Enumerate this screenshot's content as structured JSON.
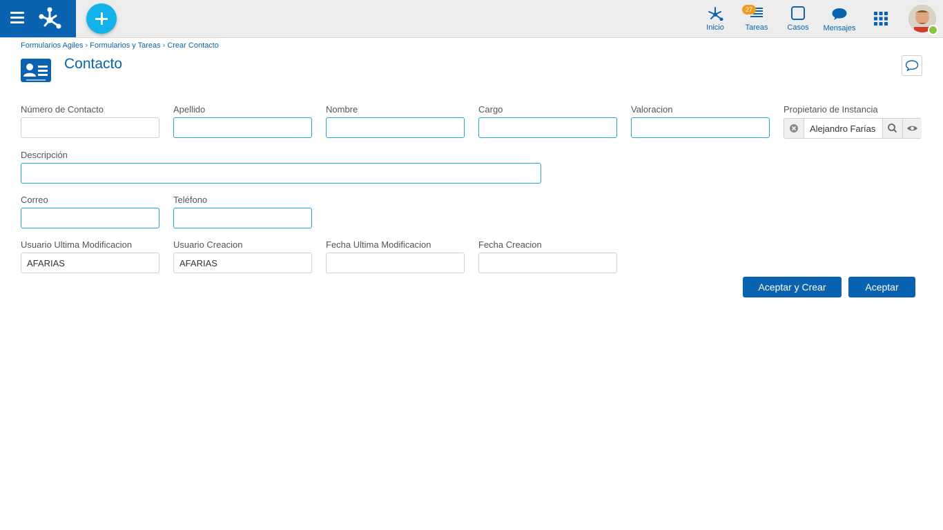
{
  "topbar": {
    "nav": [
      {
        "label": "Inicio",
        "icon": "home-network-icon"
      },
      {
        "label": "Tareas",
        "icon": "tasks-icon",
        "badge": "27"
      },
      {
        "label": "Casos",
        "icon": "cases-icon"
      },
      {
        "label": "Mensajes",
        "icon": "messages-icon"
      }
    ],
    "accent": "#0a63b1",
    "add_color": "#12b3ea",
    "badge_color": "#f29c1f"
  },
  "breadcrumb": [
    "Formularios Agiles",
    "Formularios y Tareas",
    "Crear Contacto"
  ],
  "page": {
    "title": "Contacto"
  },
  "form": {
    "numero": {
      "label": "Número de Contacto",
      "value": ""
    },
    "apellido": {
      "label": "Apellido",
      "value": ""
    },
    "nombre": {
      "label": "Nombre",
      "value": ""
    },
    "cargo": {
      "label": "Cargo",
      "value": ""
    },
    "valoracion": {
      "label": "Valoracion",
      "value": ""
    },
    "propietario": {
      "label": "Propietario de Instancia",
      "value": "Alejandro Farías"
    },
    "descripcion": {
      "label": "Descripción",
      "value": ""
    },
    "correo": {
      "label": "Correo",
      "value": ""
    },
    "telefono": {
      "label": "Teléfono",
      "value": ""
    },
    "usuario_mod": {
      "label": "Usuario Ultima Modificacion",
      "value": "AFARIAS"
    },
    "usuario_crea": {
      "label": "Usuario Creacion",
      "value": "AFARIAS"
    },
    "fecha_mod": {
      "label": "Fecha Ultima Modificacion",
      "value": ""
    },
    "fecha_crea": {
      "label": "Fecha Creacion",
      "value": ""
    }
  },
  "actions": {
    "accept_create": "Aceptar y Crear",
    "accept": "Aceptar"
  }
}
